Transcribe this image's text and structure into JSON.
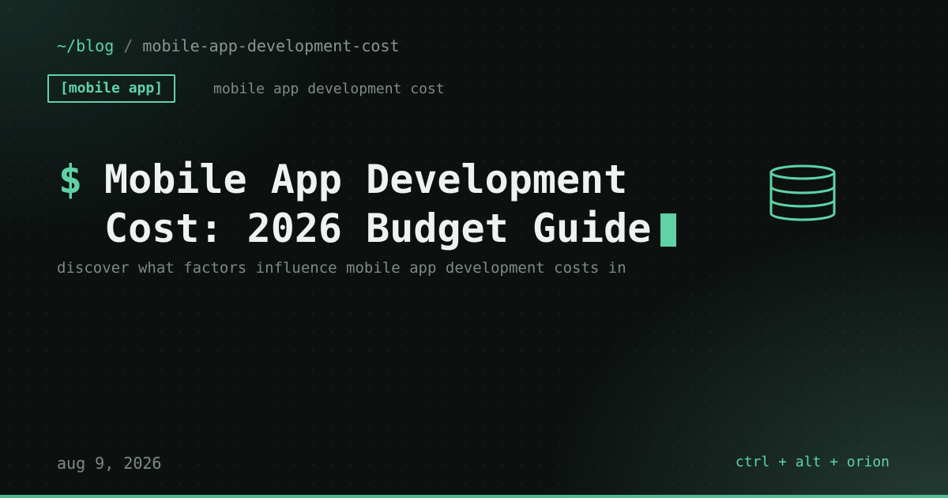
{
  "breadcrumb": {
    "home": "~/blog",
    "separator": "/",
    "slug": "mobile-app-development-cost"
  },
  "tag": {
    "label": "[mobile app]",
    "subtitle": "mobile app development cost"
  },
  "title": {
    "prompt": "$",
    "text": "Mobile App Development Cost: 2026 Budget Guide"
  },
  "description": "discover what factors influence mobile app development costs in",
  "footer": {
    "date": "aug 9, 2026",
    "shortcut": "ctrl + alt + orion"
  },
  "icons": {
    "hero": "database-icon",
    "cursor": "terminal-cursor"
  },
  "colors": {
    "accent": "#5fd3a6",
    "background": "#0c1110",
    "title": "#eef2f1",
    "muted": "#7e8985"
  }
}
